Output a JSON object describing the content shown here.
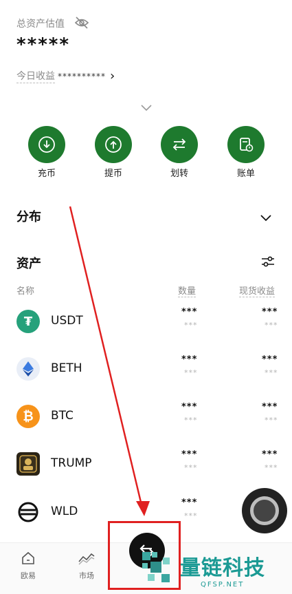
{
  "header": {
    "total_label": "总资产估值",
    "total_value": "*****",
    "today_label": "今日收益",
    "today_value": "**********",
    "chevron": "›"
  },
  "actions": [
    {
      "label": "充币",
      "icon": "deposit-icon"
    },
    {
      "label": "提币",
      "icon": "withdraw-icon"
    },
    {
      "label": "划转",
      "icon": "transfer-icon"
    },
    {
      "label": "账单",
      "icon": "bill-icon"
    }
  ],
  "distribution": {
    "title": "分布"
  },
  "assets": {
    "title": "资产",
    "col_name": "名称",
    "col_amount": "数量",
    "col_pnl": "现货收益",
    "rows": [
      {
        "name": "USDT",
        "amount": "***",
        "amount_sub": "***",
        "pnl": "***",
        "pnl_sub": "***"
      },
      {
        "name": "BETH",
        "amount": "***",
        "amount_sub": "***",
        "pnl": "***",
        "pnl_sub": "***"
      },
      {
        "name": "BTC",
        "amount": "***",
        "amount_sub": "***",
        "pnl": "***",
        "pnl_sub": "***"
      },
      {
        "name": "TRUMP",
        "amount": "***",
        "amount_sub": "***",
        "pnl": "***",
        "pnl_sub": "***"
      },
      {
        "name": "WLD",
        "amount": "***",
        "amount_sub": "***",
        "pnl": "",
        "pnl_sub": ""
      }
    ]
  },
  "bottom_nav": [
    {
      "label": "欧易",
      "icon": "home-icon"
    },
    {
      "label": "市场",
      "icon": "market-icon"
    }
  ],
  "watermark": {
    "text": "量链科技",
    "sub": "QFSP.NET"
  },
  "colors": {
    "accent": "#1e7a2e",
    "annotation": "#e02020"
  }
}
